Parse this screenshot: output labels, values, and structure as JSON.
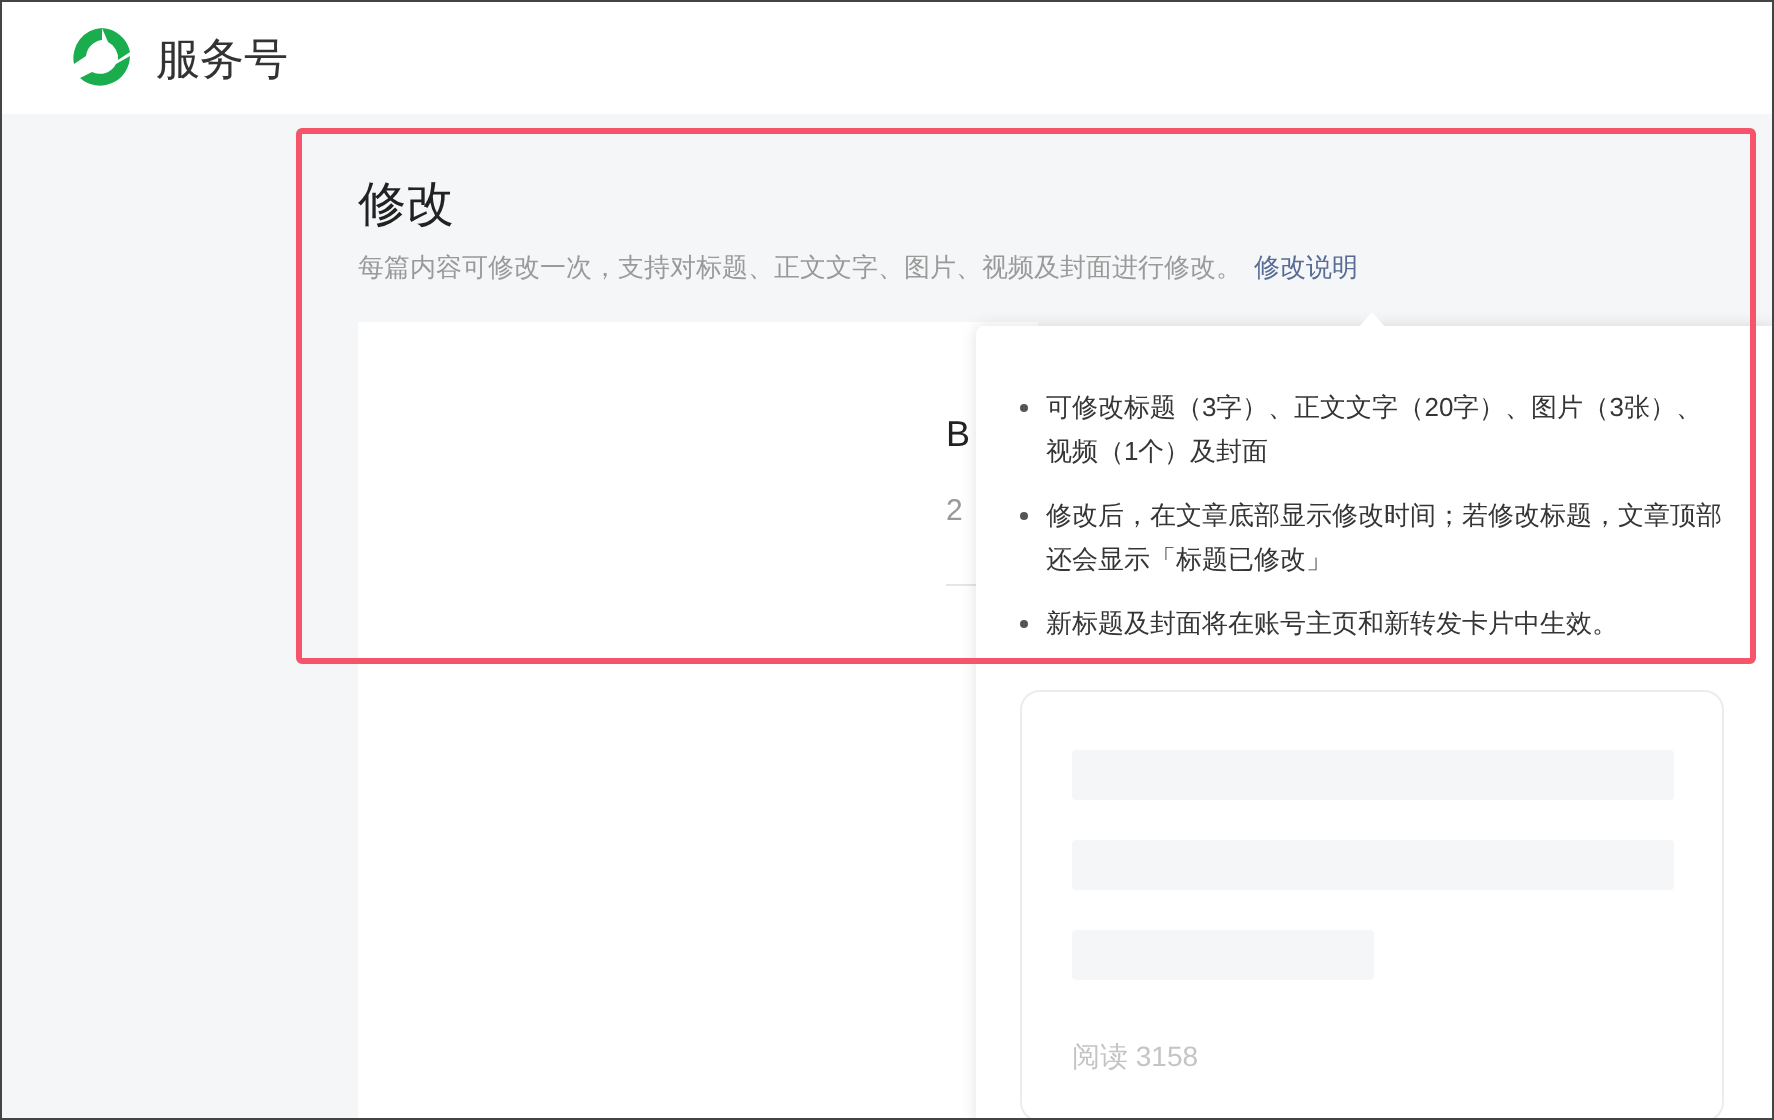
{
  "header": {
    "title": "服务号"
  },
  "page": {
    "title": "修改",
    "description": "每篇内容可修改一次，支持对标题、正文文字、图片、视频及封面进行修改。",
    "help_link": "修改说明"
  },
  "article": {
    "title": "B",
    "date": "2"
  },
  "popover": {
    "items": [
      "可修改标题（3字）、正文文字（20字）、图片（3张）、视频（1个）及封面",
      "修改后，在文章底部显示修改时间；若修改标题，文章顶部还会显示「标题已修改」",
      "新标题及封面将在账号主页和新转发卡片中生效。"
    ],
    "preview": {
      "stats": "阅读 3158"
    }
  }
}
